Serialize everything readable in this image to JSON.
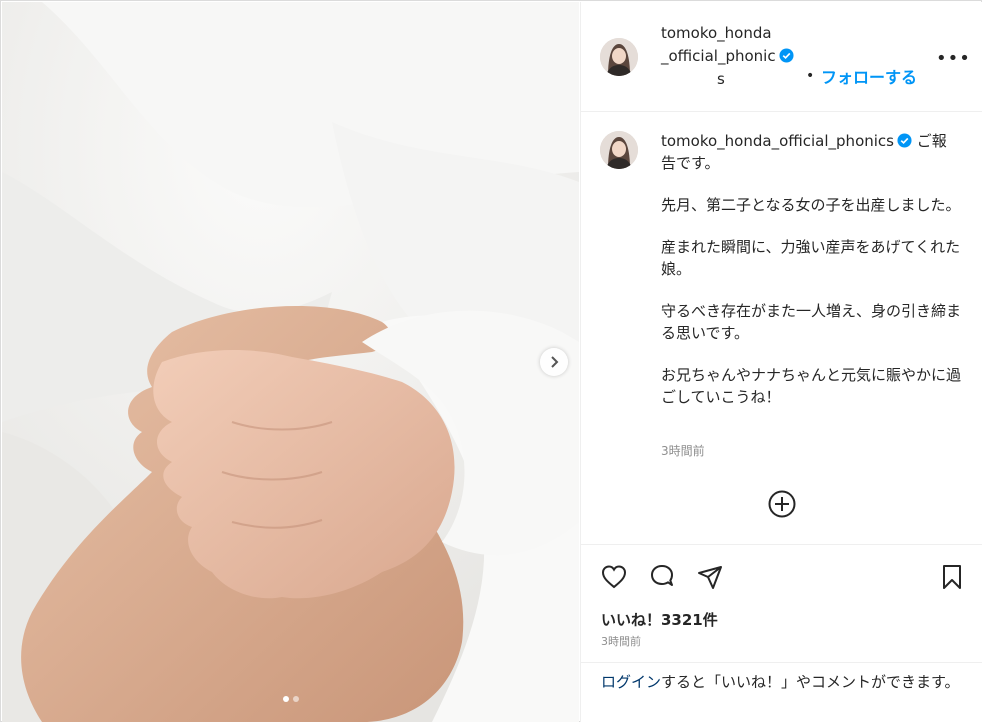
{
  "post": {
    "username": "tomoko_honda_official_phonics",
    "header_name_line1": "tomoko_honda",
    "header_name_line2": "_official_phonic",
    "header_name_line3": "s",
    "separator": "•",
    "follow_label": "フォローする",
    "more_label": "•••",
    "caption_lines": [
      "ご報告です。",
      "先月、第二子となる女の子を出産しました。",
      "産まれた瞬間に、力強い産声をあげてくれた娘。",
      "守るべき存在がまた一人増え、身の引き締まる思いです。",
      "お兄ちゃんやナナちゃんと元気に賑やかに過ごしていこうね！"
    ],
    "caption_time": "3時間前",
    "likes_label": "いいね！3321件",
    "time_label": "3時間前",
    "carousel": {
      "current": 1,
      "total": 2
    }
  },
  "login": {
    "link_label": "ログイン",
    "rest_label": "すると「いいね！」やコメントができます。"
  },
  "icons": {
    "verified": "verified-badge-icon",
    "heart": "heart-icon",
    "comment": "comment-icon",
    "share": "share-icon",
    "bookmark": "bookmark-icon",
    "add": "add-comment-icon",
    "next": "chevron-right-icon"
  },
  "colors": {
    "accent": "#0095f6",
    "verified": "#0095f6",
    "text": "#262626",
    "muted": "#8e8e8e"
  }
}
